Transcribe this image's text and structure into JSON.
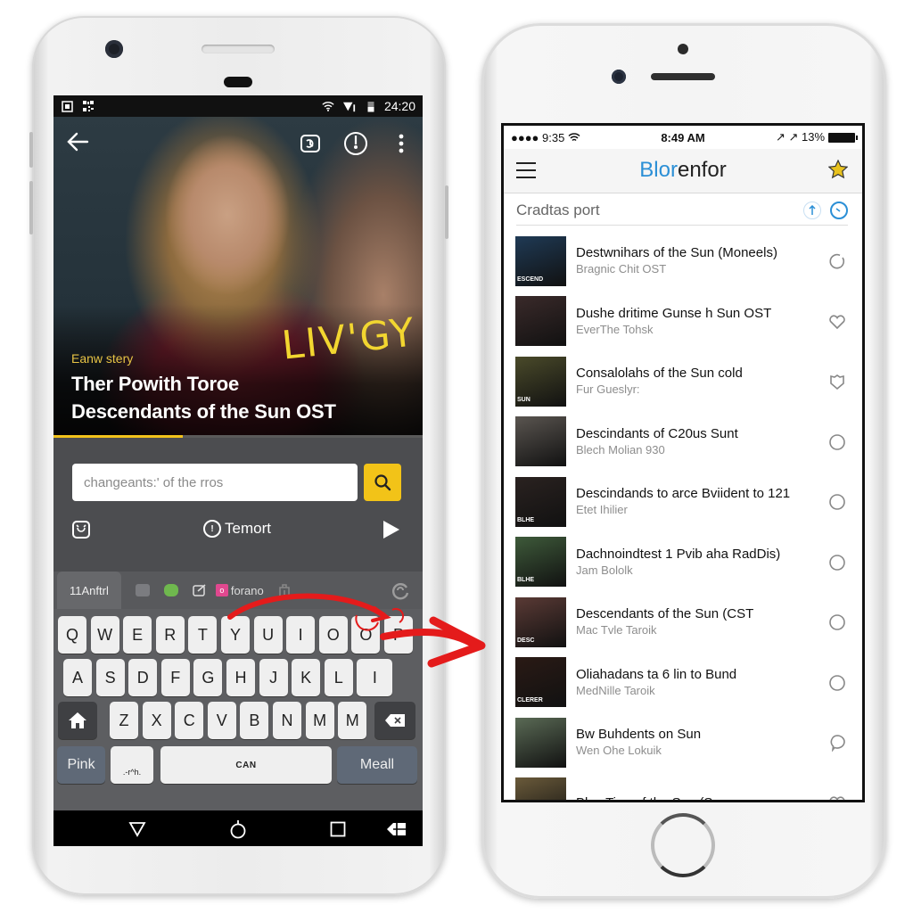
{
  "android": {
    "status_bar": {
      "left_icons": [
        "screenshot-icon",
        "qr-code-icon"
      ],
      "right_icons": [
        "wifi-icon",
        "signal-icon",
        "battery-icon"
      ],
      "time": "24:20"
    },
    "hero": {
      "kicker": "Eanw stery",
      "title_line1": "Ther Powith Toroe",
      "title_line2": "Descendants of the Sun OST",
      "overlay_text": "LIV'GY",
      "progress": 0.35,
      "icons": [
        "back-arrow-icon",
        "cast-icon",
        "power-icon",
        "more-vert-icon"
      ]
    },
    "search": {
      "value": "changeants:' of the rros",
      "placeholder": "changeants:' of the rros",
      "button_icon": "search-icon"
    },
    "sub_row": {
      "left_icon": "alarm-icon",
      "center_label": "Temort",
      "right_icon": "play-icon"
    },
    "keyboard": {
      "toolbar": {
        "active_tab": "11Anftrl",
        "tool_label": "forano",
        "tools": [
          "grid-icon",
          "sticker-icon",
          "edit-icon",
          "app-icon",
          "clipboard-icon"
        ],
        "right_icon": "refresh-icon"
      },
      "row1": [
        "Q",
        "W",
        "E",
        "R",
        "T",
        "Y",
        "U",
        "I",
        "O",
        "O",
        "P"
      ],
      "row2": [
        "A",
        "S",
        "D",
        "F",
        "G",
        "H",
        "J",
        "K",
        "L",
        "I"
      ],
      "row3": [
        "Z",
        "X",
        "C",
        "V",
        "B",
        "N",
        "M",
        "M"
      ],
      "bottom": {
        "left": "Pink",
        "second": ".-r^h.",
        "space": "CAN",
        "right": "Meall"
      }
    },
    "nav_bar": [
      "back-triangle-icon",
      "home-circle-icon",
      "recents-square-icon",
      "menu-flag-icon"
    ]
  },
  "iphone": {
    "status_bar": {
      "left": "●●●● 9:35",
      "center": "8:49 AM",
      "right": "↗ ↗ 13%"
    },
    "nav": {
      "logo_accent": "Blor",
      "logo_rest": "enfor",
      "accent_color": "#2b8fd6"
    },
    "search": {
      "value": "Cradtas port",
      "placeholder": "Cradtas port"
    },
    "list": [
      {
        "title": "Destwnihars of the Sun (Moneels)",
        "subtitle": "Bragnic Chit OST",
        "thumb_color": "#1f3a55",
        "thumb_label": "ESCEND",
        "action": "refresh-circle-icon"
      },
      {
        "title": "Dushe dritime Gunse h Sun OST",
        "subtitle": "EverThe Tohsk",
        "thumb_color": "#3a2a2a",
        "thumb_label": "",
        "action": "heart-icon"
      },
      {
        "title": "Consalolahs of the Sun cold",
        "subtitle": "Fur Gueslyr:",
        "thumb_color": "#4a4a2a",
        "thumb_label": "SUN",
        "action": "shield-heart-icon"
      },
      {
        "title": "Descindants of C20us Sunt",
        "subtitle": "Blech Molian 930",
        "thumb_color": "#5a5550",
        "thumb_label": "",
        "action": "circle-icon"
      },
      {
        "title": "Descindands to arce Bviident to 121",
        "subtitle": "Etet Ihilier",
        "thumb_color": "#2a2220",
        "thumb_label": "BLHE",
        "action": "circle-icon"
      },
      {
        "title": "Dachnoindtest 1 Pvib aha RadDis)",
        "subtitle": "Jam Bololk",
        "thumb_color": "#3e5a3a",
        "thumb_label": "BLHE",
        "action": "circle-icon"
      },
      {
        "title": "Descendants of the Sun (CST",
        "subtitle": "Mac Tvle Taroik",
        "thumb_color": "#5a3a35",
        "thumb_label": "DESC",
        "action": "circle-icon"
      },
      {
        "title": "Oliahadans ta 6 lin to Bund",
        "subtitle": "MedNille Taroik",
        "thumb_color": "#2a1a15",
        "thumb_label": "CLERER",
        "action": "circle-icon"
      },
      {
        "title": "Bw Buhdents on Sun",
        "subtitle": "Wen Ohe Lokuik",
        "thumb_color": "#5a6a55",
        "thumb_label": "",
        "action": "chat-bubble-icon"
      },
      {
        "title": "Blas Tipe of the Sun (Sun",
        "subtitle": "",
        "thumb_color": "#6a5a3a",
        "thumb_label": "",
        "action": "heart-icon"
      }
    ]
  },
  "annotation": {
    "color": "#e41b1b",
    "meaning": "arrow-from-keyboard-to-list"
  }
}
